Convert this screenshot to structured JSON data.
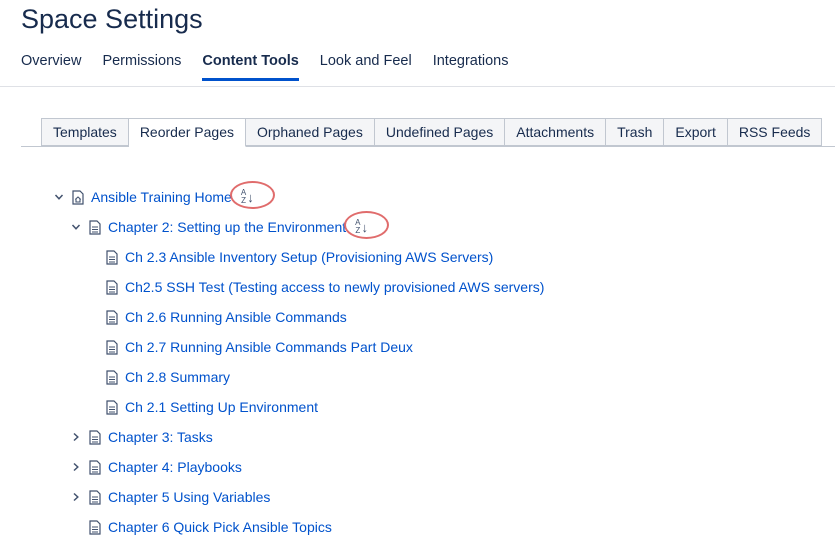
{
  "header": {
    "title": "Space Settings"
  },
  "topnav": [
    {
      "label": "Overview",
      "active": false
    },
    {
      "label": "Permissions",
      "active": false
    },
    {
      "label": "Content Tools",
      "active": true
    },
    {
      "label": "Look and Feel",
      "active": false
    },
    {
      "label": "Integrations",
      "active": false
    }
  ],
  "tabs": [
    {
      "label": "Templates",
      "active": false
    },
    {
      "label": "Reorder Pages",
      "active": true
    },
    {
      "label": "Orphaned Pages",
      "active": false
    },
    {
      "label": "Undefined Pages",
      "active": false
    },
    {
      "label": "Attachments",
      "active": false
    },
    {
      "label": "Trash",
      "active": false
    },
    {
      "label": "Export",
      "active": false
    },
    {
      "label": "RSS Feeds",
      "active": false
    }
  ],
  "tree": {
    "root": {
      "label": "Ansible Training Home",
      "icon": "home-page-icon",
      "expanded": true
    },
    "chapter2": {
      "label": "Chapter 2: Setting up the Environment",
      "expanded": true
    },
    "chapter2_children": [
      "Ch 2.3 Ansible Inventory Setup (Provisioning AWS Servers)",
      "Ch2.5 SSH Test (Testing access to newly provisioned AWS servers)",
      "Ch 2.6 Running Ansible Commands",
      "Ch 2.7 Running Ansible Commands Part Deux",
      "Ch 2.8 Summary",
      "Ch 2.1 Setting Up Environment"
    ],
    "other_chapters": [
      {
        "label": "Chapter 3: Tasks",
        "expandable": true
      },
      {
        "label": "Chapter 4: Playbooks",
        "expandable": true
      },
      {
        "label": "Chapter 5 Using Variables",
        "expandable": true
      },
      {
        "label": "Chapter 6 Quick Pick Ansible Topics",
        "expandable": false
      }
    ],
    "sort_icon": {
      "top": "A",
      "bottom": "Z",
      "arrow": "↓"
    }
  },
  "colors": {
    "link": "#0052cc",
    "accent": "#0052cc",
    "annotation_circle": "#e06c6c"
  }
}
